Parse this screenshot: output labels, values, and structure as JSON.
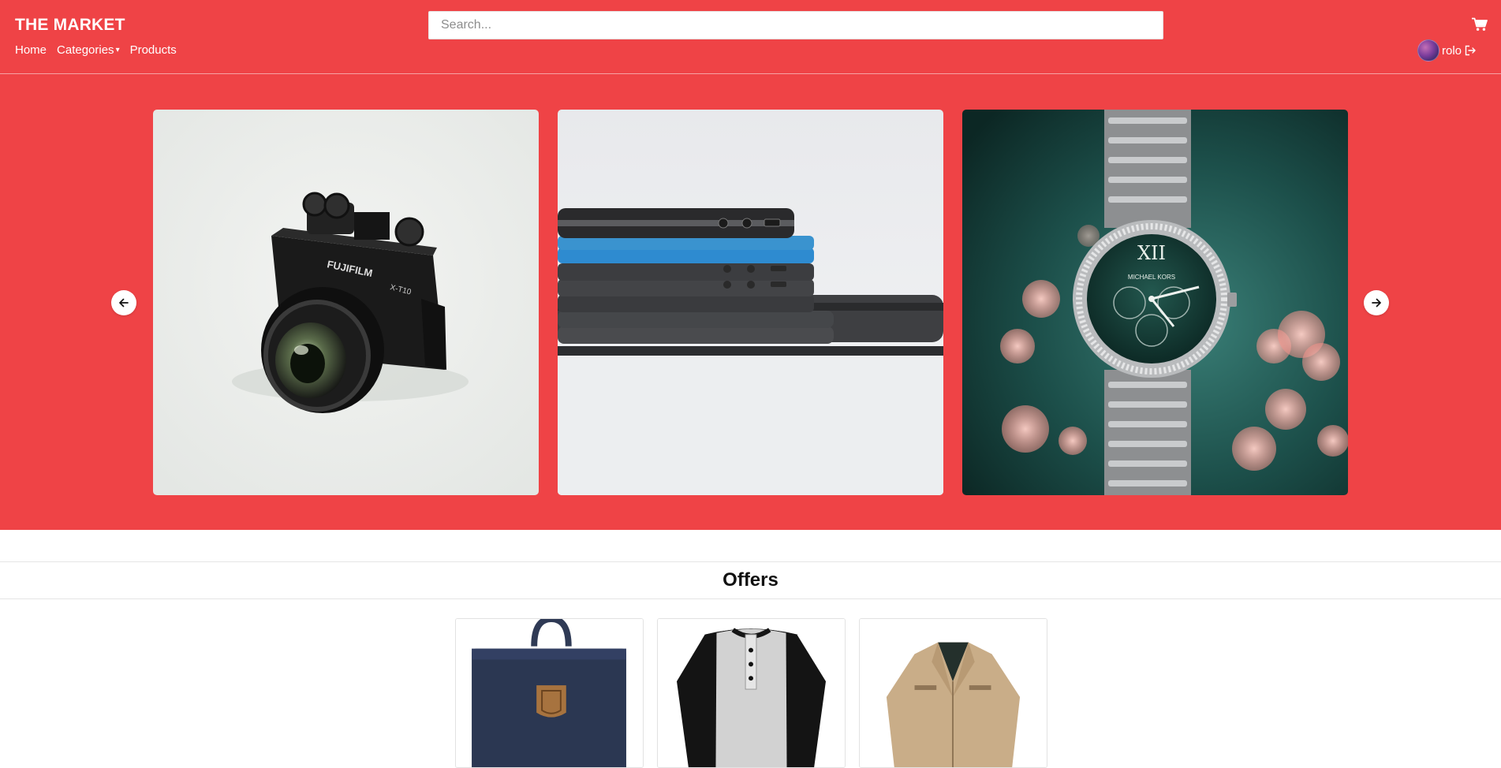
{
  "header": {
    "brand": "THE MARKET",
    "search_placeholder": "Search...",
    "cart_icon": "cart-icon",
    "nav": {
      "home": "Home",
      "categories": "Categories",
      "categories_caret": "▾",
      "products": "Products"
    },
    "user": {
      "name": "rolo",
      "avatar_icon": "avatar",
      "logout_icon": "logout-icon"
    },
    "accent_color": "#ef4346"
  },
  "carousel": {
    "prev_icon": "arrow-left-icon",
    "next_icon": "arrow-right-icon",
    "slides": [
      {
        "subject": "camera"
      },
      {
        "subject": "phones"
      },
      {
        "subject": "watch"
      }
    ]
  },
  "offers": {
    "title": "Offers",
    "items": [
      {
        "subject": "backpack"
      },
      {
        "subject": "henley-shirt"
      },
      {
        "subject": "jacket"
      }
    ]
  }
}
